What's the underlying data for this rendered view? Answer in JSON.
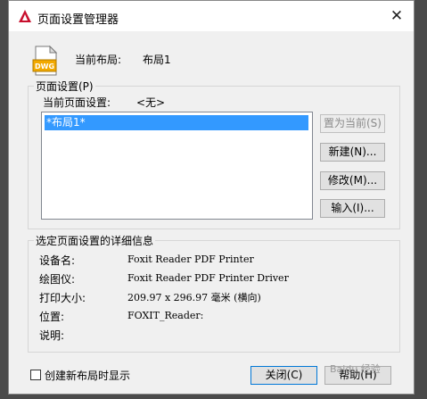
{
  "window": {
    "title": "页面设置管理器",
    "close_glyph": "✕"
  },
  "current_layout": {
    "label": "当前布局:",
    "value": "布局1"
  },
  "icon": {
    "name": "dwg-file-icon",
    "text": "DWG"
  },
  "page_setups": {
    "group_title": "页面设置(P)",
    "current_label": "当前页面设置:",
    "current_value": "<无>",
    "items": [
      "*布局1*"
    ]
  },
  "buttons": {
    "set_current": "置为当前(S)",
    "new": "新建(N)...",
    "modify": "修改(M)...",
    "import": "输入(I)...",
    "close": "关闭(C)",
    "help": "帮助(H)"
  },
  "details": {
    "group_title": "选定页面设置的详细信息",
    "rows": [
      {
        "label": "设备名:",
        "value": "Foxit Reader PDF Printer"
      },
      {
        "label": "绘图仪:",
        "value": "Foxit Reader PDF Printer Driver"
      },
      {
        "label": "打印大小:",
        "value": "209.97 x 296.97 毫米 (横向)"
      },
      {
        "label": "位置:",
        "value": "FOXIT_Reader:"
      },
      {
        "label": "说明:",
        "value": ""
      }
    ]
  },
  "footer": {
    "checkbox_label": "创建新布局时显示",
    "checkbox_checked": false,
    "watermark": "Baidu 经验"
  }
}
